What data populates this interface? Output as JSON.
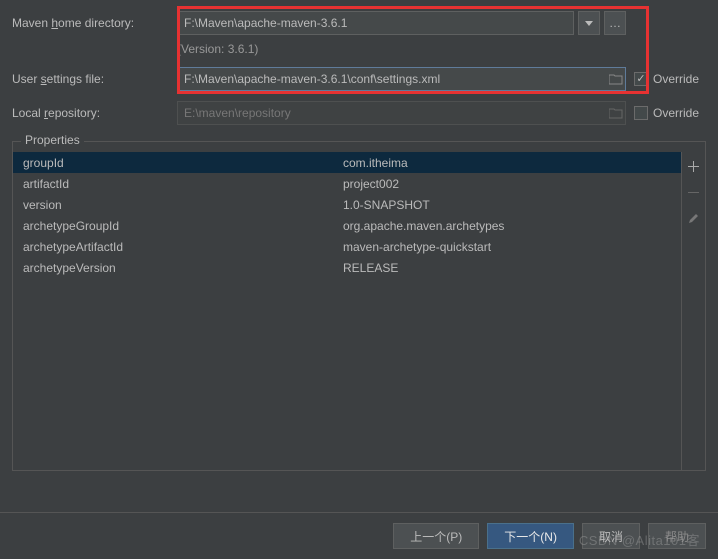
{
  "fields": {
    "maven_home": {
      "label_pre": "Maven ",
      "label_mn": "h",
      "label_post": "ome directory:",
      "value": "F:\\Maven\\apache-maven-3.6.1"
    },
    "version_text": "(Version: 3.6.1)",
    "user_settings": {
      "label_pre": "User ",
      "label_mn": "s",
      "label_post": "ettings file:",
      "value": "F:\\Maven\\apache-maven-3.6.1\\conf\\settings.xml",
      "override_label": "Override",
      "override_checked": true
    },
    "local_repo": {
      "label_pre": "Local ",
      "label_mn": "r",
      "label_post": "epository:",
      "value": "E:\\maven\\repository",
      "override_label": "Override",
      "override_checked": false
    }
  },
  "properties": {
    "title": "Properties",
    "rows": [
      {
        "key": "groupId",
        "value": "com.itheima"
      },
      {
        "key": "artifactId",
        "value": "project002"
      },
      {
        "key": "version",
        "value": "1.0-SNAPSHOT"
      },
      {
        "key": "archetypeGroupId",
        "value": "org.apache.maven.archetypes"
      },
      {
        "key": "archetypeArtifactId",
        "value": "maven-archetype-quickstart"
      },
      {
        "key": "archetypeVersion",
        "value": "RELEASE"
      }
    ]
  },
  "buttons": {
    "prev": "上一个(P)",
    "next": "下一个(N)",
    "cancel": "取消",
    "help": "帮助"
  },
  "watermark": "CSDN @Alita101客"
}
